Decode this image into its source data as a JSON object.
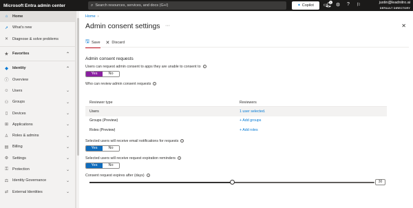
{
  "topbar": {
    "brand": "Microsoft Entra admin center",
    "search_placeholder": "Search resources, services, and docs (G+/)",
    "copilot_label": "Copilot",
    "notification_count": "1",
    "user_email": "justin@leadnitro.ai",
    "user_directory": "DEFAULT DIRECTORY"
  },
  "sidebar": {
    "items": [
      {
        "label": "Home",
        "icon": "home-icon"
      },
      {
        "label": "What's new",
        "icon": "rocket-icon"
      },
      {
        "label": "Diagnose & solve problems",
        "icon": "wrench-icon"
      },
      {
        "label": "Favorites",
        "icon": "star-icon"
      },
      {
        "label": "Identity",
        "icon": "diamond-icon"
      },
      {
        "label": "Overview",
        "icon": "info-icon"
      },
      {
        "label": "Users",
        "icon": "user-icon"
      },
      {
        "label": "Groups",
        "icon": "group-icon"
      },
      {
        "label": "Devices",
        "icon": "device-icon"
      },
      {
        "label": "Applications",
        "icon": "apps-icon"
      },
      {
        "label": "Roles & admins",
        "icon": "roles-icon"
      },
      {
        "label": "Billing",
        "icon": "billing-icon"
      },
      {
        "label": "Settings",
        "icon": "gear-icon"
      },
      {
        "label": "Protection",
        "icon": "lock-icon"
      },
      {
        "label": "Identity Governance",
        "icon": "governance-icon"
      },
      {
        "label": "External Identities",
        "icon": "external-icon"
      }
    ]
  },
  "main": {
    "breadcrumb": "Home",
    "title": "Admin consent settings",
    "toolbar": {
      "save": "Save",
      "discard": "Discard"
    },
    "section_title": "Admin consent requests",
    "q_request": "Users can request admin consent to apps they are unable to consent to",
    "q_reviewers": "Who can review admin consent requests",
    "q_email": "Selected users will receive email notifications for requests",
    "q_reminders": "Selected users will receive request expiration reminders",
    "q_expires": "Consent request expires after (days)",
    "toggle_yes": "Yes",
    "toggle_no": "No",
    "toggle_request_selected": "Yes",
    "toggle_email_selected": "Yes",
    "toggle_reminders_selected": "Yes",
    "table": {
      "headers": [
        "Reviewer type",
        "Reviewers"
      ],
      "rows": [
        {
          "type": "Users",
          "value": "1 user selected."
        },
        {
          "type": "Groups (Preview)",
          "value": "+ Add groups"
        },
        {
          "type": "Roles (Preview)",
          "value": "+ Add roles"
        }
      ]
    },
    "slider": {
      "value": "30",
      "min": 1,
      "max": 30,
      "fraction": 0.5
    }
  },
  "colors": {
    "topbar": "#1b1a19",
    "accent": "#0078d4",
    "toggle_request": "#8a1fa1",
    "toggle_default": "#0f6cbd"
  }
}
